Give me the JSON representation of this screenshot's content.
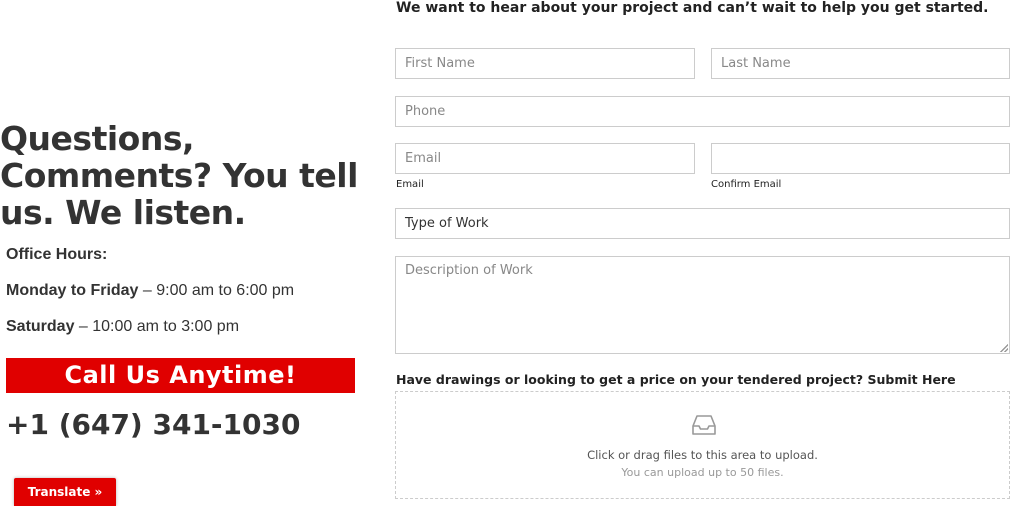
{
  "contact": {
    "heading": "Questions, Comments? You tell us. We listen.",
    "office_hours_title": "Office Hours:",
    "hours": [
      {
        "days": "Monday to Friday",
        "time": " – 9:00 am to 6:00 pm"
      },
      {
        "days": "Saturday",
        "time": " – 10:00 am to 3:00 pm"
      }
    ],
    "cta_label": "Call Us Anytime!",
    "phone": "+1 (647) 341-1030"
  },
  "translate": {
    "label": "Translate »"
  },
  "form": {
    "intro": "We want to hear about your project and can’t wait to help you get started.",
    "first_name_placeholder": "First Name",
    "last_name_placeholder": "Last Name",
    "phone_placeholder": "Phone",
    "email_placeholder": "Email",
    "email_label": "Email",
    "confirm_email_label": "Confirm Email",
    "type_of_work_value": "Type of Work",
    "description_placeholder": "Description of Work",
    "upload_label": "Have drawings or looking to get a price on your tendered project? Submit Here",
    "dropzone_text": "Click or drag files to this area to upload.",
    "dropzone_limit": "You can upload up to 50 files.",
    "upload_icon": "inbox-icon"
  },
  "colors": {
    "accent": "#e00000",
    "border": "#cccccc",
    "text": "#333333"
  }
}
